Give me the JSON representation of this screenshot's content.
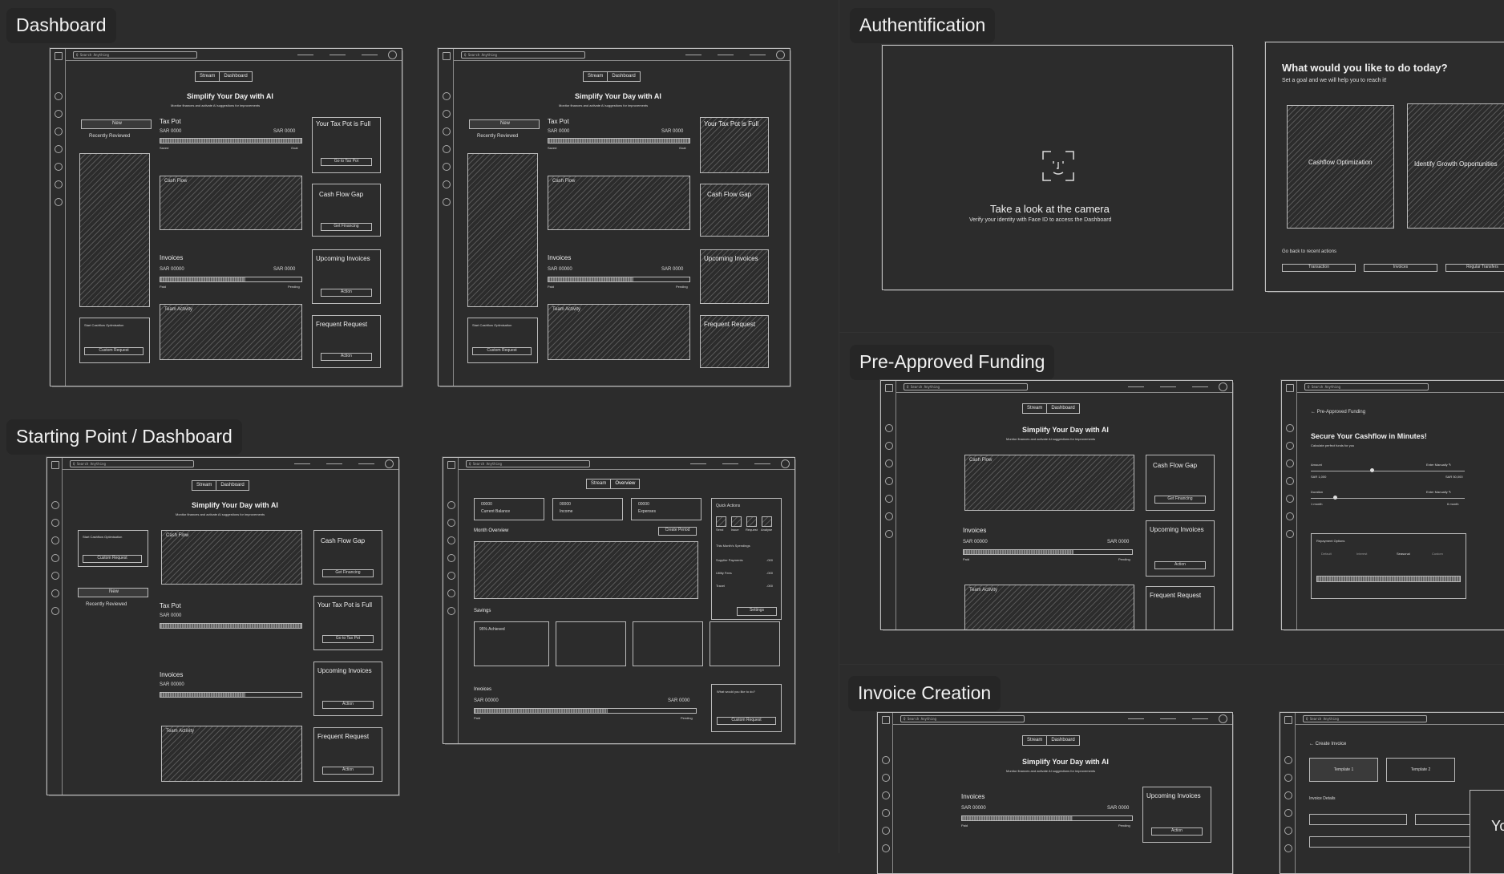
{
  "sections": {
    "dashboard": "Dashboard",
    "starting_point": "Starting Point / Dashboard",
    "authentication": "Authentification",
    "pre_approved_funding": "Pre-Approved Funding",
    "invoice_creation": "Invoice Creation"
  },
  "common": {
    "search_placeholder": "Q Search Anything",
    "tab_stream": "Stream",
    "tab_dashboard": "Dashboard",
    "tab_overview": "Overview",
    "hero_title": "Simplify Your Day with AI",
    "hero_subtitle": "Monitor finances and activate AI suggestions for improvements",
    "new_label": "New",
    "recently_reviewed": "Recently Reviewed",
    "tax_pot": "Tax Pot",
    "sar_0000": "SAR 0000",
    "sar_00000": "SAR 00000",
    "saved": "Saved",
    "goal": "Goal",
    "paid": "Paid",
    "pending": "Pending",
    "cash_flow": "Cash Flow",
    "invoices": "Invoices",
    "team_activity": "Team Activity",
    "tax_pot_full": "Your Tax Pot is Full",
    "go_to_tax_pot": "Go to Tax Pot",
    "cash_flow_gap": "Cash Flow Gap",
    "get_financing": "Get Financing",
    "upcoming_invoices": "Upcoming Invoices",
    "action": "Action",
    "frequent_request": "Frequent Request",
    "cashflow_optimisation": "Start Cashflow Optimisation",
    "custom_request": "Custom Request"
  },
  "overview": {
    "current_balance": "Current Balance",
    "income": "Income",
    "expenses": "Expenses",
    "value": "00000",
    "month_overview": "Month Overview",
    "create_period": "Create Period",
    "quick_actions": "Quick Actions",
    "qa_items": [
      "Send",
      "Issue",
      "Request",
      "Analyse"
    ],
    "spendings": "This Month's Spendings",
    "spend_items": [
      {
        "label": "Supplier Payments",
        "value": "-000"
      },
      {
        "label": "Utility Fees",
        "value": "-000"
      },
      {
        "label": "Travel",
        "value": "-000"
      }
    ],
    "savings": "Savings",
    "settings": "Settings",
    "achieved": "95% Achieved",
    "what_would": "What would you like to do?"
  },
  "auth": {
    "title": "Take a look at the camera",
    "subtitle": "Verify your identity with Face ID to access the Dashboard",
    "question": "What would you like to do today?",
    "question_sub": "Set a goal and we will help you to reach it!",
    "option1": "Cashflow Optimization",
    "option2": "Identify Growth Opportunities",
    "recent_actions": "Go back to recent actions",
    "recent_btns": [
      "Transaction",
      "Invoices",
      "Regular Transfers"
    ]
  },
  "funding": {
    "back": "← Pre-Approved Funding",
    "title": "Secure Your Cashflow in Minutes!",
    "subtitle": "Calculate perfect funds for you",
    "amount": "Amount",
    "duration": "Duration",
    "enter_manually": "Enter Manually ✎",
    "sar_low": "SAR 1,000",
    "sar_high": "SAR 50,000",
    "month_low": "1 month",
    "month_high": "6 month",
    "repayment": "Repayment Options",
    "rep_tabs": [
      "Default",
      "Interest",
      "Seasonal",
      "Custom"
    ]
  },
  "invoice": {
    "back": "← Create Invoice",
    "template1": "Template 1",
    "template2": "Template 2",
    "invoice_details": "Invoice Details",
    "cut_text": "Yo"
  }
}
